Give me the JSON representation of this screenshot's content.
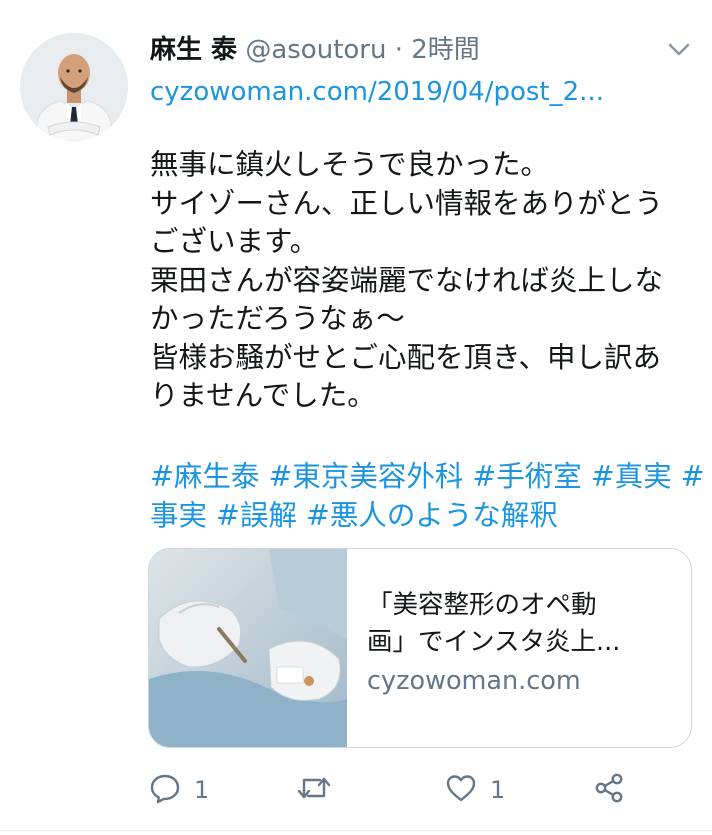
{
  "author": {
    "display_name": "麻生 泰",
    "handle": "@asoutoru",
    "separator": "·",
    "time": "2時間"
  },
  "link_text": "cyzowoman.com/2019/04/post_2...",
  "body_lines": [
    "無事に鎮火しそうで良かった。",
    "サイゾーさん、正しい情報をありがとう",
    "ございます。",
    "栗田さんが容姿端麗でなければ炎上しな",
    "かっただろうなぁ～",
    "皆様お騒がせとご心配を頂き、申し訳あ",
    "りませんでした。"
  ],
  "hashtag_lines": [
    "#麻生泰 #東京美容外科 #手術室 #真実 #",
    "事実 #誤解 #悪人のような解釈"
  ],
  "card": {
    "title_lines": [
      "「美容整形のオペ動",
      "画」でインスタ炎上..."
    ],
    "domain": "cyzowoman.com"
  },
  "actions": {
    "reply_count": "1",
    "like_count": "1"
  },
  "icons": {
    "caret": "chevron-down-icon",
    "reply": "reply-icon",
    "retweet": "retweet-icon",
    "like": "heart-icon",
    "share": "share-icon"
  },
  "colors": {
    "link": "#1b95e0",
    "text": "#14171a",
    "secondary": "#657786",
    "border": "#ccd6dd"
  }
}
